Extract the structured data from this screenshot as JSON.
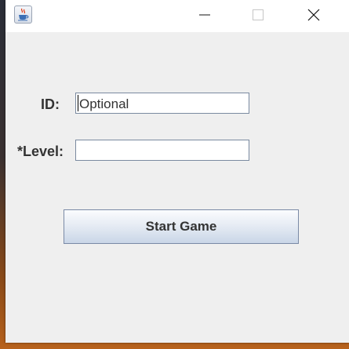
{
  "window": {
    "icon": "java-coffee-cup-icon",
    "controls": {
      "minimize_icon": "minimize-icon",
      "maximize_icon": "maximize-icon",
      "close_icon": "close-icon"
    }
  },
  "form": {
    "id_label": "ID:",
    "id_value": "Optional",
    "level_label": "*Level:",
    "level_value": "",
    "start_button_label": "Start Game"
  },
  "colors": {
    "window_background": "#efefef",
    "titlebar_background": "#ffffff",
    "field_border": "#7a8aa0",
    "button_gradient_top": "#fbfcfe",
    "button_gradient_bottom": "#c9d6e7",
    "text": "#333333"
  }
}
